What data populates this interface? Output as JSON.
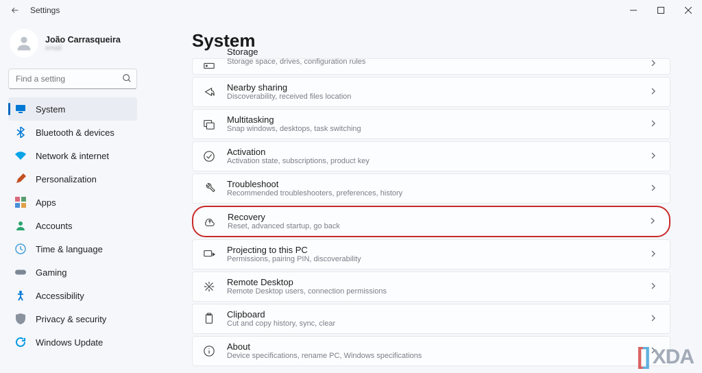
{
  "window": {
    "title": "Settings"
  },
  "profile": {
    "name": "João Carrasqueira",
    "email_placeholder": "email"
  },
  "search": {
    "placeholder": "Find a setting"
  },
  "sidebar": {
    "items": [
      {
        "label": "System",
        "icon": "display",
        "color": "#0078d4",
        "active": true
      },
      {
        "label": "Bluetooth & devices",
        "icon": "bluetooth",
        "color": "#0078d4"
      },
      {
        "label": "Network & internet",
        "icon": "wifi",
        "color": "#0aa3e8"
      },
      {
        "label": "Personalization",
        "icon": "brush",
        "color": "#c44f20"
      },
      {
        "label": "Apps",
        "icon": "apps",
        "color": "#c95b6b"
      },
      {
        "label": "Accounts",
        "icon": "person",
        "color": "#2aa56f"
      },
      {
        "label": "Time & language",
        "icon": "clock",
        "color": "#4a9fd7"
      },
      {
        "label": "Gaming",
        "icon": "gamepad",
        "color": "#7b8794"
      },
      {
        "label": "Accessibility",
        "icon": "accessibility",
        "color": "#0078d4"
      },
      {
        "label": "Privacy & security",
        "icon": "shield",
        "color": "#8a929e"
      },
      {
        "label": "Windows Update",
        "icon": "update",
        "color": "#0099e5"
      }
    ]
  },
  "page": {
    "title": "System",
    "items": [
      {
        "title": "Storage",
        "subtitle": "Storage space, drives, configuration rules",
        "icon": "storage",
        "cut": true
      },
      {
        "title": "Nearby sharing",
        "subtitle": "Discoverability, received files location",
        "icon": "share"
      },
      {
        "title": "Multitasking",
        "subtitle": "Snap windows, desktops, task switching",
        "icon": "multitask"
      },
      {
        "title": "Activation",
        "subtitle": "Activation state, subscriptions, product key",
        "icon": "check"
      },
      {
        "title": "Troubleshoot",
        "subtitle": "Recommended troubleshooters, preferences, history",
        "icon": "wrench"
      },
      {
        "title": "Recovery",
        "subtitle": "Reset, advanced startup, go back",
        "icon": "recovery",
        "highlight": true
      },
      {
        "title": "Projecting to this PC",
        "subtitle": "Permissions, pairing PIN, discoverability",
        "icon": "project"
      },
      {
        "title": "Remote Desktop",
        "subtitle": "Remote Desktop users, connection permissions",
        "icon": "remote"
      },
      {
        "title": "Clipboard",
        "subtitle": "Cut and copy history, sync, clear",
        "icon": "clipboard"
      },
      {
        "title": "About",
        "subtitle": "Device specifications, rename PC, Windows specifications",
        "icon": "info"
      }
    ]
  },
  "watermark": "XDA"
}
